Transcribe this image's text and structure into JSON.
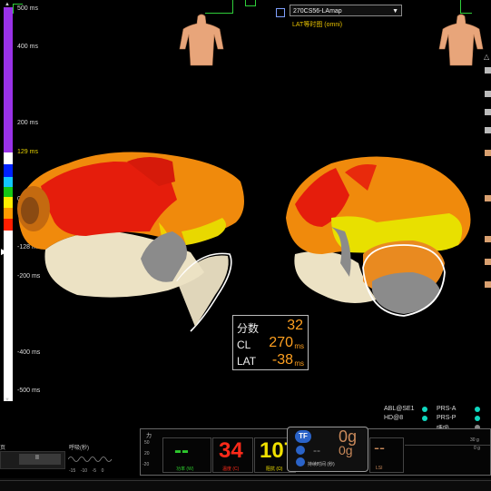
{
  "header": {
    "map_name": "270CS56-LAmap",
    "map_subtitle": "LAT等时图 (omni)"
  },
  "lat_scale": {
    "labels": [
      "500 ms",
      "400 ms",
      "200 ms",
      "129 ms",
      "0 ms",
      "-128 ms",
      "-200 ms",
      "-400 ms",
      "-500 ms"
    ],
    "colors": [
      "#8a2be2",
      "#a040f0",
      "#0026ff",
      "#18c8ff",
      "#20d020",
      "#ffee00",
      "#ff9900",
      "#ff2000",
      "#ffffff"
    ]
  },
  "info_box": {
    "score_label": "分数",
    "score_value": "32",
    "cl_label": "CL",
    "cl_value": "270",
    "cl_unit": "ms",
    "lat_label": "LAT",
    "lat_value": "-38",
    "lat_unit": "ms"
  },
  "legend": {
    "items": [
      {
        "label": "ABL@SE1"
      },
      {
        "label": "PRS-A"
      },
      {
        "label": "HD@8"
      },
      {
        "label": "PRS-P"
      }
    ],
    "breath_label": "呼吸"
  },
  "bottom_panel": {
    "left_label": "力",
    "axis_labels": [
      "50",
      "20",
      "-20"
    ],
    "force_dash": "--",
    "force_caption": "功率 (W)",
    "temp_value": "34",
    "temp_caption": "温度 (C)",
    "impedance_value": "107",
    "impedance_caption": "阻抗 (Ω)",
    "tf_badge": "TF",
    "contact_value": "0g",
    "contact_value2": "0g",
    "contact_dash": "--",
    "time_caption": "持续时间 (秒)",
    "lsi_caption": "LSI",
    "right_axis_top": "30 g",
    "right_axis_mid": "0 g"
  },
  "left_panel": {
    "breath_title": "呼吸(秒)",
    "resp_title": "页",
    "ticks": [
      "-15",
      "-10",
      "-5",
      "0"
    ],
    "pause_label": "II"
  }
}
